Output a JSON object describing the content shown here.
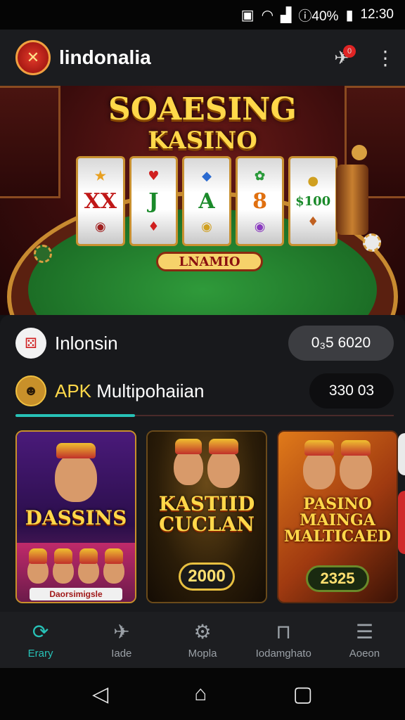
{
  "status_bar": {
    "signal_text": "ⓘ40%",
    "time": "12:30"
  },
  "app_bar": {
    "title": "lindonalia",
    "logo_icon": "casino-logo-icon",
    "notification_badge": "0",
    "menu_icon": "more-vert-icon"
  },
  "banner": {
    "title_line1": "SOAESING",
    "title_line2": "KASINO",
    "plate_text": "LNAMIO",
    "reels": [
      {
        "top": "★",
        "mid": "XX",
        "bot": "◉"
      },
      {
        "top": "♥",
        "mid": "J",
        "bot": "♦"
      },
      {
        "top": "◆",
        "mid": "A",
        "bot": "◉"
      },
      {
        "top": "✿",
        "mid": "8",
        "bot": "◉"
      },
      {
        "top": "●",
        "mid": "$100",
        "bot": "♦"
      }
    ]
  },
  "rows": [
    {
      "label": "Inlonsin",
      "value": "0₃5 6020"
    },
    {
      "label_prefix": "APK",
      "label": " Multipohaiian",
      "value": "330 03"
    }
  ],
  "cards": [
    {
      "title": "DASSINS",
      "subtitle": "Daorsimigsle",
      "colors": {
        "bg1": "#3a1a6a",
        "bg2": "#8a2a6a"
      }
    },
    {
      "title": "KASTIID\nCUCLAN",
      "badge": "2000",
      "colors": {
        "bg1": "#3a2a10",
        "bg2": "#1a1206"
      }
    },
    {
      "title": "PASINO\nMAINGA\nMALTICAED",
      "badge": "2325",
      "colors": {
        "bg1": "#c86a1a",
        "bg2": "#5a2a10"
      }
    }
  ],
  "bottom_nav": [
    {
      "label": "Erary",
      "icon": "refresh-icon",
      "active": true
    },
    {
      "label": "Iade",
      "icon": "send-icon",
      "active": false
    },
    {
      "label": "Mopla",
      "icon": "settings-icon",
      "active": false
    },
    {
      "label": "Iodamghato",
      "icon": "basket-icon",
      "active": false
    },
    {
      "label": "Aoeon",
      "icon": "list-icon",
      "active": false
    }
  ],
  "colors": {
    "accent": "#27c2b7",
    "gold": "#ffd84a",
    "red": "#e02424"
  }
}
